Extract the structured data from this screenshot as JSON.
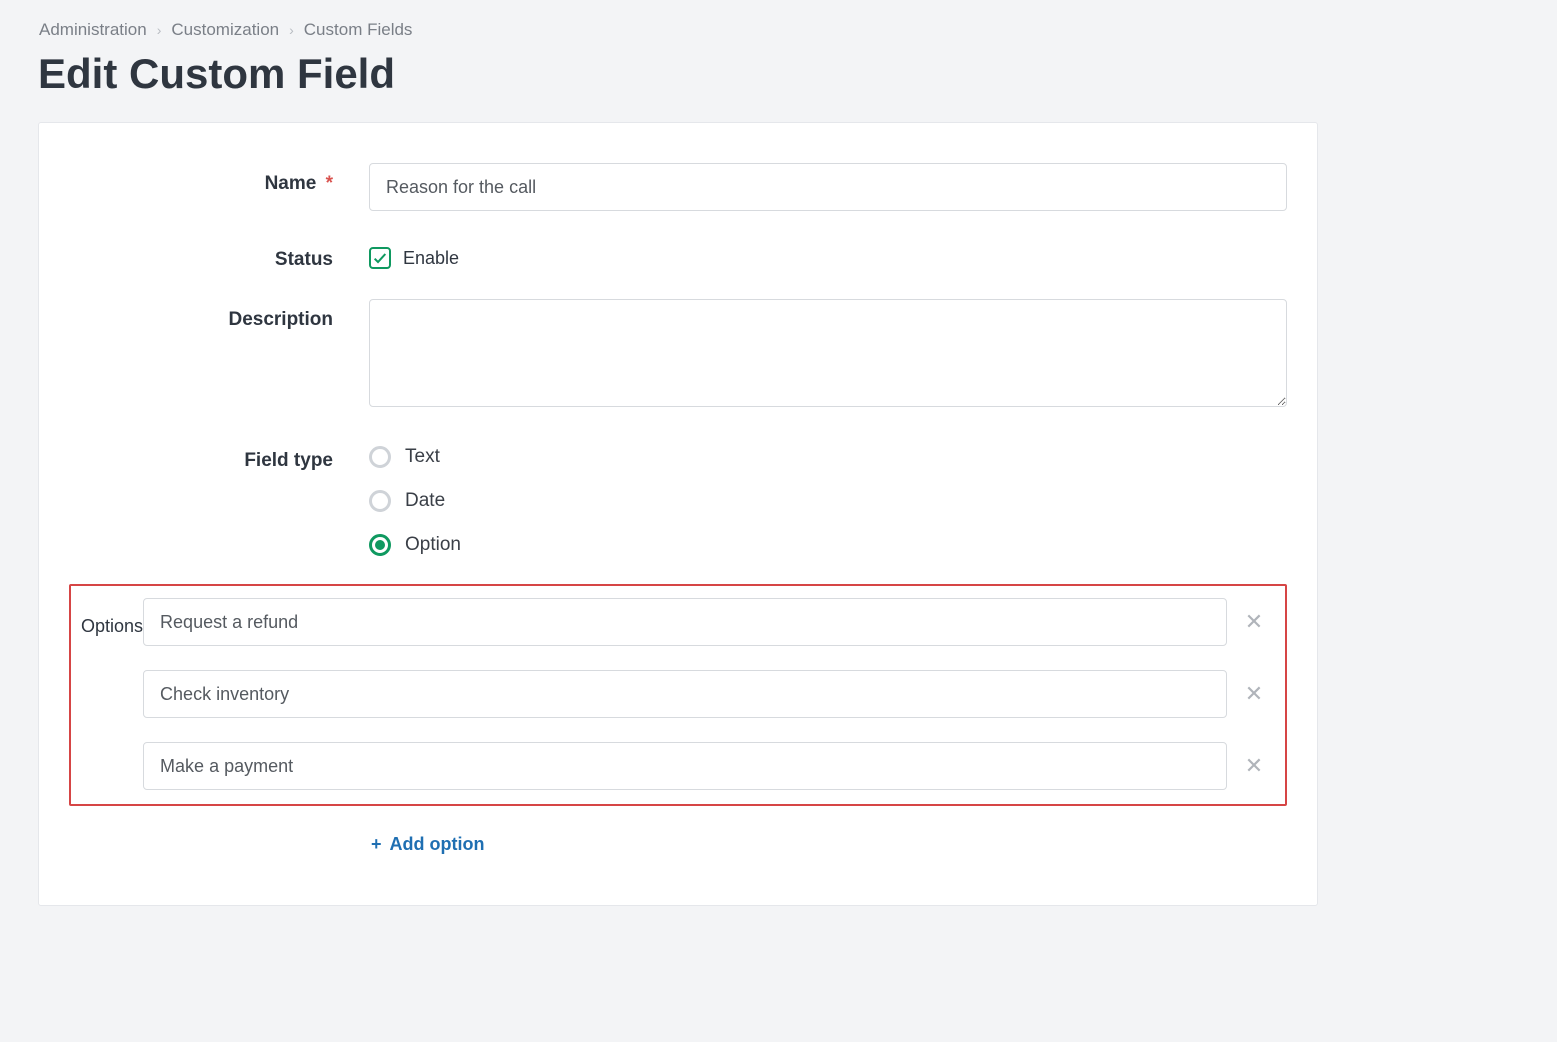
{
  "breadcrumb": {
    "items": [
      {
        "label": "Administration"
      },
      {
        "label": "Customization"
      },
      {
        "label": "Custom Fields"
      }
    ]
  },
  "page": {
    "title": "Edit Custom Field"
  },
  "form": {
    "name": {
      "label": "Name",
      "required_mark": "*",
      "value": "Reason for the call"
    },
    "status": {
      "label": "Status",
      "checkbox_label": "Enable",
      "checked": true
    },
    "description": {
      "label": "Description",
      "value": ""
    },
    "field_type": {
      "label": "Field type",
      "options": [
        {
          "label": "Text",
          "selected": false
        },
        {
          "label": "Date",
          "selected": false
        },
        {
          "label": "Option",
          "selected": true
        }
      ]
    },
    "options": {
      "label": "Options",
      "items": [
        {
          "value": "Request a refund"
        },
        {
          "value": "Check inventory"
        },
        {
          "value": "Make a payment"
        }
      ],
      "add_label": "Add option"
    }
  },
  "colors": {
    "accent_green": "#0f9960",
    "link_blue": "#1f6fb2",
    "highlight_red": "#d64545",
    "required_red": "#d9534f"
  }
}
